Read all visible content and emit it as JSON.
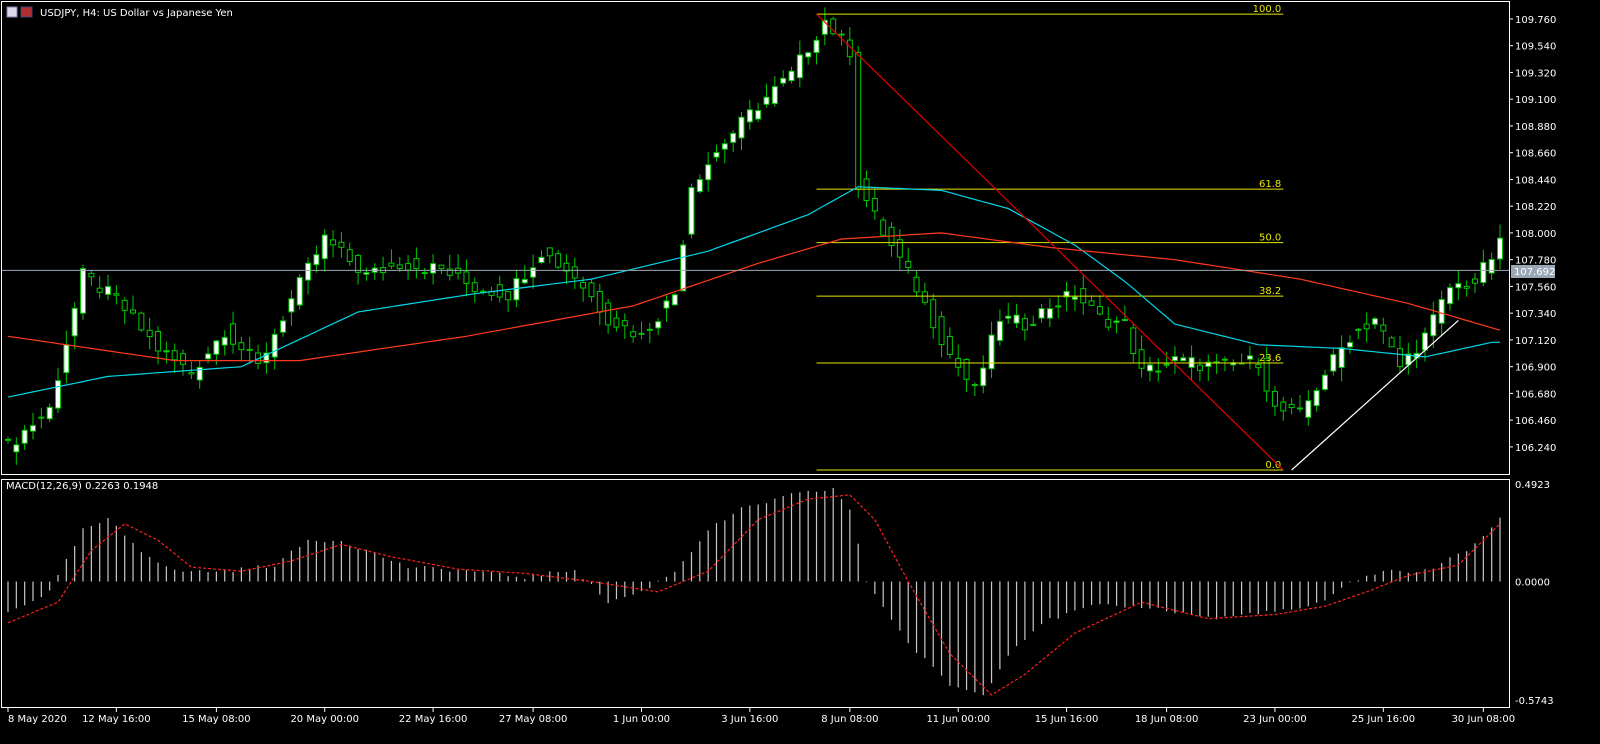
{
  "window": {
    "title": "USDJPY, H4:  US Dollar vs Japanese Yen"
  },
  "colors": {
    "background": "#000000",
    "bull_candle": "#ffffff",
    "bear_candle": "#000000",
    "wick": "#00c800",
    "ma_fast": "#00d8e8",
    "ma_slow": "#ff3a1c",
    "fib": "#e6e600",
    "trend_down": "#e00000",
    "trend_up": "#ffffff",
    "price_line": "#9aa7b5",
    "macd_hist": "#c8c8c8",
    "macd_signal": "#ff2020",
    "axis_text": "#ffffff",
    "grid": "#ffffff"
  },
  "chart_data": [
    {
      "type": "candlestick",
      "symbol": "USDJPY",
      "timeframe": "H4",
      "title": "USDJPY, H4:  US Dollar vs Japanese Yen",
      "current_price": "107.692",
      "ylim": [
        106.05,
        109.85
      ],
      "price_ticks": [
        "109.760",
        "109.540",
        "109.320",
        "109.100",
        "108.880",
        "108.660",
        "108.440",
        "108.220",
        "108.000",
        "107.780",
        "107.560",
        "107.340",
        "107.120",
        "106.900",
        "106.680",
        "106.460",
        "106.240"
      ],
      "x_tick_labels": [
        "8 May 2020",
        "12 May 16:00",
        "15 May 08:00",
        "20 May 00:00",
        "22 May 16:00",
        "27 May 08:00",
        "1 Jun 00:00",
        "3 Jun 16:00",
        "8 Jun 08:00",
        "11 Jun 00:00",
        "15 Jun 16:00",
        "18 Jun 08:00",
        "23 Jun 00:00",
        "25 Jun 16:00",
        "30 Jun 08:00"
      ],
      "bars": 180,
      "waypoints": [
        [
          0,
          106.25
        ],
        [
          5,
          106.55
        ],
        [
          9,
          107.65
        ],
        [
          13,
          107.45
        ],
        [
          18,
          107.05
        ],
        [
          22,
          106.85
        ],
        [
          26,
          107.2
        ],
        [
          30,
          106.9
        ],
        [
          34,
          107.45
        ],
        [
          38,
          107.95
        ],
        [
          43,
          107.65
        ],
        [
          47,
          107.75
        ],
        [
          52,
          107.7
        ],
        [
          56,
          107.55
        ],
        [
          60,
          107.5
        ],
        [
          64,
          107.85
        ],
        [
          68,
          107.65
        ],
        [
          72,
          107.3
        ],
        [
          76,
          107.15
        ],
        [
          80,
          107.5
        ],
        [
          82,
          108.4
        ],
        [
          86,
          108.75
        ],
        [
          90,
          109.05
        ],
        [
          94,
          109.3
        ],
        [
          98,
          109.75
        ],
        [
          101,
          109.5
        ],
        [
          102,
          108.4
        ],
        [
          105,
          108.0
        ],
        [
          109,
          107.55
        ],
        [
          113,
          107.0
        ],
        [
          116,
          106.7
        ],
        [
          119,
          107.3
        ],
        [
          122,
          107.25
        ],
        [
          125,
          107.4
        ],
        [
          128,
          107.5
        ],
        [
          131,
          107.3
        ],
        [
          134,
          107.25
        ],
        [
          136,
          106.85
        ],
        [
          140,
          106.95
        ],
        [
          145,
          106.9
        ],
        [
          150,
          106.95
        ],
        [
          152,
          106.55
        ],
        [
          155,
          106.5
        ],
        [
          158,
          106.85
        ],
        [
          161,
          107.15
        ],
        [
          164,
          107.3
        ],
        [
          167,
          106.9
        ],
        [
          170,
          107.15
        ],
        [
          173,
          107.55
        ],
        [
          176,
          107.6
        ],
        [
          179,
          107.9
        ]
      ],
      "ma_fast": [
        [
          0,
          106.65
        ],
        [
          12,
          106.82
        ],
        [
          28,
          106.9
        ],
        [
          42,
          107.35
        ],
        [
          56,
          107.5
        ],
        [
          70,
          107.62
        ],
        [
          84,
          107.85
        ],
        [
          96,
          108.15
        ],
        [
          102,
          108.38
        ],
        [
          112,
          108.35
        ],
        [
          120,
          108.2
        ],
        [
          128,
          107.9
        ],
        [
          134,
          107.6
        ],
        [
          140,
          107.25
        ],
        [
          150,
          107.08
        ],
        [
          160,
          107.05
        ],
        [
          170,
          106.98
        ],
        [
          178,
          107.1
        ]
      ],
      "ma_slow": [
        [
          0,
          107.15
        ],
        [
          20,
          106.95
        ],
        [
          35,
          106.95
        ],
        [
          55,
          107.15
        ],
        [
          75,
          107.4
        ],
        [
          90,
          107.75
        ],
        [
          100,
          107.95
        ],
        [
          112,
          108.0
        ],
        [
          125,
          107.88
        ],
        [
          140,
          107.78
        ],
        [
          155,
          107.62
        ],
        [
          168,
          107.42
        ],
        [
          179,
          107.2
        ]
      ],
      "fibonacci": {
        "levels": [
          {
            "label": "100.0",
            "price": 109.8
          },
          {
            "label": "61.8",
            "price": 108.36
          },
          {
            "label": "50.0",
            "price": 107.92
          },
          {
            "label": "38.2",
            "price": 107.48
          },
          {
            "label": "23.6",
            "price": 106.93
          },
          {
            "label": "0.0",
            "price": 106.05
          }
        ],
        "from_bar": 97,
        "to_bar": 153
      },
      "trend_lines": [
        {
          "name": "down",
          "from": [
            97,
            109.8
          ],
          "to": [
            153,
            106.05
          ]
        },
        {
          "name": "up",
          "from": [
            154,
            106.05
          ],
          "to": [
            174,
            107.28
          ]
        }
      ]
    },
    {
      "type": "bar",
      "indicator": "MACD(12,26,9)",
      "label": "MACD(12,26,9) 0.2263 0.1948",
      "ylim": [
        -0.5743,
        0.4923
      ],
      "y_ticks": [
        "0.4923",
        "0.0000",
        "-0.5743"
      ],
      "hist_waypoints": [
        [
          0,
          -0.15
        ],
        [
          5,
          -0.05
        ],
        [
          9,
          0.25
        ],
        [
          12,
          0.3
        ],
        [
          16,
          0.15
        ],
        [
          20,
          0.05
        ],
        [
          26,
          0.05
        ],
        [
          32,
          0.08
        ],
        [
          36,
          0.2
        ],
        [
          40,
          0.2
        ],
        [
          48,
          0.07
        ],
        [
          56,
          0.05
        ],
        [
          62,
          0.02
        ],
        [
          68,
          0.06
        ],
        [
          72,
          -0.1
        ],
        [
          76,
          -0.05
        ],
        [
          80,
          0.05
        ],
        [
          84,
          0.25
        ],
        [
          88,
          0.35
        ],
        [
          94,
          0.42
        ],
        [
          99,
          0.45
        ],
        [
          101,
          0.35
        ],
        [
          103,
          0.0
        ],
        [
          108,
          -0.3
        ],
        [
          113,
          -0.5
        ],
        [
          117,
          -0.55
        ],
        [
          120,
          -0.35
        ],
        [
          124,
          -0.2
        ],
        [
          130,
          -0.12
        ],
        [
          136,
          -0.12
        ],
        [
          145,
          -0.18
        ],
        [
          150,
          -0.15
        ],
        [
          154,
          -0.14
        ],
        [
          158,
          -0.1
        ],
        [
          161,
          0.0
        ],
        [
          165,
          0.05
        ],
        [
          170,
          0.05
        ],
        [
          175,
          0.15
        ],
        [
          179,
          0.3
        ]
      ],
      "signal_waypoints": [
        [
          0,
          -0.2
        ],
        [
          6,
          -0.1
        ],
        [
          10,
          0.15
        ],
        [
          14,
          0.28
        ],
        [
          18,
          0.2
        ],
        [
          22,
          0.07
        ],
        [
          28,
          0.05
        ],
        [
          34,
          0.1
        ],
        [
          40,
          0.18
        ],
        [
          46,
          0.12
        ],
        [
          54,
          0.06
        ],
        [
          62,
          0.04
        ],
        [
          70,
          0.0
        ],
        [
          78,
          -0.05
        ],
        [
          84,
          0.05
        ],
        [
          90,
          0.3
        ],
        [
          96,
          0.4
        ],
        [
          101,
          0.42
        ],
        [
          104,
          0.3
        ],
        [
          108,
          0.0
        ],
        [
          113,
          -0.35
        ],
        [
          118,
          -0.55
        ],
        [
          122,
          -0.45
        ],
        [
          128,
          -0.25
        ],
        [
          136,
          -0.1
        ],
        [
          144,
          -0.18
        ],
        [
          152,
          -0.16
        ],
        [
          158,
          -0.12
        ],
        [
          163,
          -0.05
        ],
        [
          168,
          0.03
        ],
        [
          174,
          0.08
        ],
        [
          179,
          0.28
        ]
      ]
    }
  ]
}
